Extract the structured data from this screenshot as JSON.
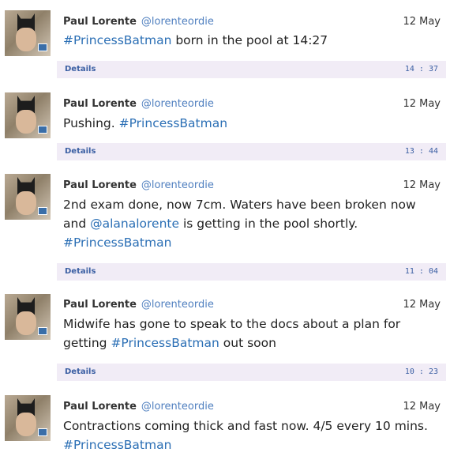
{
  "tweets": [
    {
      "user_name": "Paul Lorente",
      "handle": "@lorenteordie",
      "date": "12 May",
      "text_before": "",
      "hashtag": "#PrincessBatman",
      "text_after": " born in the pool at 14:27",
      "details_label": "Details",
      "time": "14 : 37"
    },
    {
      "user_name": "Paul Lorente",
      "handle": "@lorenteordie",
      "date": "12 May",
      "text_before": "Pushing. ",
      "hashtag": "#PrincessBatman",
      "text_after": "",
      "details_label": "Details",
      "time": "13 : 44"
    },
    {
      "user_name": "Paul Lorente",
      "handle": "@lorenteordie",
      "date": "12 May",
      "text_before": "2nd exam done, now 7cm. Waters have been broken now and ",
      "mention": "@alanalorente",
      "text_mid": " is getting in the pool shortly.",
      "hashtag": "#PrincessBatman",
      "details_label": "Details",
      "time": "11 : 04"
    },
    {
      "user_name": "Paul Lorente",
      "handle": "@lorenteordie",
      "date": "12 May",
      "text_before": "Midwife has gone to speak to the docs about a plan for getting ",
      "hashtag": "#PrincessBatman",
      "text_after": " out soon",
      "details_label": "Details",
      "time": "10 : 23"
    },
    {
      "user_name": "Paul Lorente",
      "handle": "@lorenteordie",
      "date": "12 May",
      "text_before": "Contractions coming thick and fast now. 4/5 every 10 mins. ",
      "hashtag": "#PrincessBatman",
      "text_after": ""
    }
  ],
  "colors": {
    "details_bg": "#f1ecf6",
    "link": "#2b6fb5",
    "handle": "#4f7fbf"
  },
  "icons": [
    "avatar-photo"
  ]
}
